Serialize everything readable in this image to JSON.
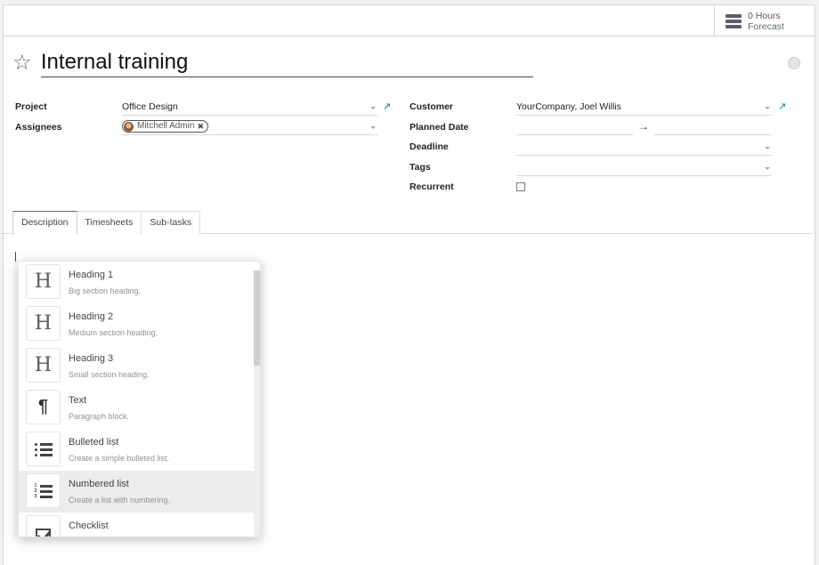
{
  "smart_button": {
    "value": "0  Hours",
    "label": "Forecast",
    "icon": "server-stack-icon"
  },
  "record": {
    "title": "Internal training",
    "favorite_icon": "star-outline-icon",
    "status_icon": "kanban-state-circle"
  },
  "fields_left": {
    "project": {
      "label": "Project",
      "value": "Office Design"
    },
    "assignees": {
      "label": "Assignees",
      "tags": [
        "Mitchell Admin"
      ]
    }
  },
  "fields_right": {
    "customer": {
      "label": "Customer",
      "value": "YourCompany, Joel Willis"
    },
    "planned_date": {
      "label": "Planned Date",
      "start": "",
      "end": "",
      "arrow": "→"
    },
    "deadline": {
      "label": "Deadline",
      "value": ""
    },
    "tags": {
      "label": "Tags",
      "value": ""
    },
    "recurrent": {
      "label": "Recurrent",
      "checked": false
    }
  },
  "tabs": [
    {
      "label": "Description",
      "active": true
    },
    {
      "label": "Timesheets",
      "active": false
    },
    {
      "label": "Sub-tasks",
      "active": false
    }
  ],
  "powerbox": {
    "items": [
      {
        "title": "Heading 1",
        "desc": "Big section heading.",
        "icon": "H"
      },
      {
        "title": "Heading 2",
        "desc": "Medium section heading.",
        "icon": "H"
      },
      {
        "title": "Heading 3",
        "desc": "Small section heading.",
        "icon": "H"
      },
      {
        "title": "Text",
        "desc": "Paragraph block.",
        "icon": "¶"
      },
      {
        "title": "Bulleted list",
        "desc": "Create a simple bulleted list.",
        "icon": "bulleted-list"
      },
      {
        "title": "Numbered list",
        "desc": "Create a list with numbering.",
        "icon": "numbered-list",
        "highlighted": true
      },
      {
        "title": "Checklist",
        "desc": "",
        "icon": "checklist"
      }
    ]
  },
  "colors": {
    "brand": "#714b67",
    "link": "#017e84"
  }
}
